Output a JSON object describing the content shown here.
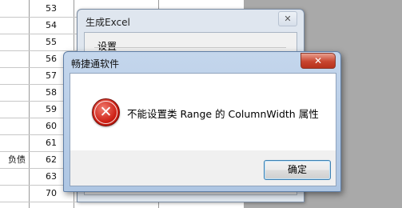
{
  "spreadsheet": {
    "rows": [
      {
        "num": "53",
        "cell": ""
      },
      {
        "num": "54",
        "cell": ""
      },
      {
        "num": "55",
        "cell": ""
      },
      {
        "num": "56",
        "cell": ""
      },
      {
        "num": "57",
        "cell": ""
      },
      {
        "num": "58",
        "cell": ""
      },
      {
        "num": "59",
        "cell": ""
      },
      {
        "num": "60",
        "cell": ""
      },
      {
        "num": "61",
        "cell": ""
      },
      {
        "num": "62",
        "cell": "负债"
      },
      {
        "num": "63",
        "cell": ""
      },
      {
        "num": "70",
        "cell": ""
      }
    ]
  },
  "back_dialog": {
    "title": "生成Excel",
    "close_glyph": "✕",
    "group_label": "设置"
  },
  "error_dialog": {
    "title": "畅捷通软件",
    "close_glyph": "✕",
    "icon": "error-icon",
    "icon_glyph": "✕",
    "message": "不能设置类 Range 的 ColumnWidth 属性",
    "ok_label": "确定"
  },
  "colors": {
    "gray_area": "#a9a9a9",
    "title_bar": "#aec6e3",
    "close_red": "#c8452f",
    "error_red": "#cc1d12"
  }
}
